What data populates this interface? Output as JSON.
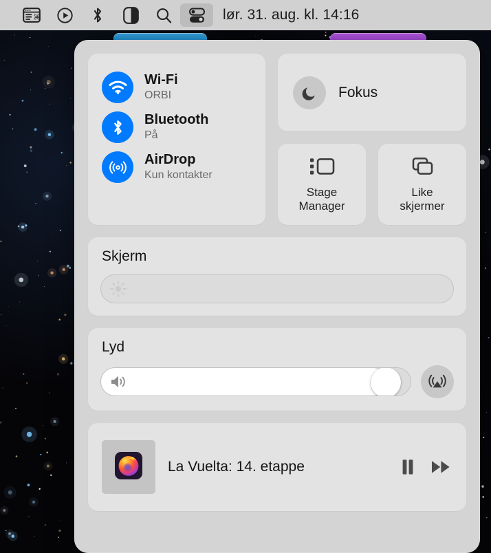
{
  "menubar": {
    "clock": "lør. 31. aug. kl. 14:16",
    "items": [
      {
        "name": "keyboard-shortcuts-icon",
        "label": "Keyboard Shortcuts",
        "active": false
      },
      {
        "name": "media-play-icon",
        "label": "Now Playing",
        "active": false
      },
      {
        "name": "bluetooth-icon",
        "label": "Bluetooth",
        "active": false
      },
      {
        "name": "display-contrast-icon",
        "label": "Display Mode",
        "active": false
      },
      {
        "name": "search-icon",
        "label": "Spotlight",
        "active": false
      },
      {
        "name": "control-center-icon",
        "label": "Control Center",
        "active": true
      }
    ]
  },
  "control_center": {
    "connectivity": [
      {
        "icon": "wifi-icon",
        "title": "Wi-Fi",
        "subtitle": "ORBI"
      },
      {
        "icon": "bluetooth-icon",
        "title": "Bluetooth",
        "subtitle": "På"
      },
      {
        "icon": "airdrop-icon",
        "title": "AirDrop",
        "subtitle": "Kun kontakter"
      }
    ],
    "focus": {
      "icon": "moon-icon",
      "label": "Fokus"
    },
    "tiles": [
      {
        "icon": "stage-manager-icon",
        "label": "Stage\nManager",
        "line1": "Stage",
        "line2": "Manager"
      },
      {
        "icon": "screen-mirroring-icon",
        "label": "Like skjermer",
        "line1": "Like",
        "line2": "skjermer"
      }
    ],
    "display": {
      "title": "Skjerm",
      "glyph": "brightness-icon",
      "value": 0
    },
    "sound": {
      "title": "Lyd",
      "glyph": "speaker-icon",
      "value": 96,
      "airplay_icon": "airplay-icon"
    },
    "media": {
      "app_icon": "firefox-icon",
      "title": "La Vuelta: 14. etappe",
      "pause_icon": "pause-icon",
      "forward_icon": "fast-forward-icon"
    }
  },
  "colors": {
    "accent_blue": "#007aff",
    "panel_bg": "#d4d4d4",
    "card_bg": "#e3e3e3",
    "menubar_bg": "#d1d1d1",
    "window_blue": "#1e8fd0",
    "window_purple": "#a84ad8"
  }
}
